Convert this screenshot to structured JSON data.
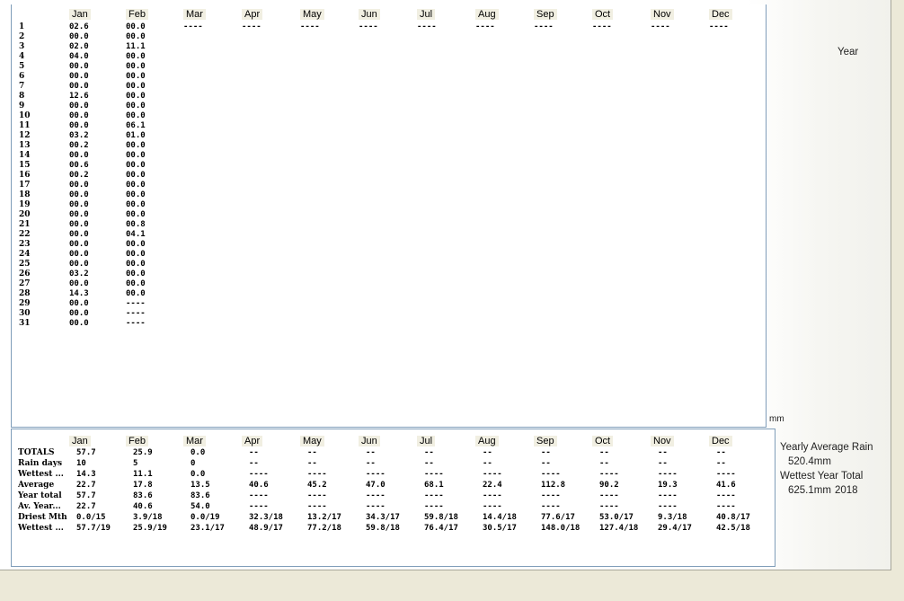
{
  "months": [
    "Jan",
    "Feb",
    "Mar",
    "Apr",
    "May",
    "Jun",
    "Jul",
    "Aug",
    "Sep",
    "Oct",
    "Nov",
    "Dec"
  ],
  "daily": {
    "days": [
      "1",
      "2",
      "3",
      "4",
      "5",
      "6",
      "7",
      "8",
      "9",
      "10",
      "11",
      "12",
      "13",
      "14",
      "15",
      "16",
      "17",
      "18",
      "19",
      "20",
      "21",
      "22",
      "23",
      "24",
      "25",
      "26",
      "27",
      "28",
      "29",
      "30",
      "31"
    ],
    "jan": [
      "02.6",
      "00.0",
      "02.0",
      "04.0",
      "00.0",
      "00.0",
      "00.0",
      "12.6",
      "00.0",
      "00.0",
      "00.0",
      "03.2",
      "00.2",
      "00.0",
      "00.6",
      "00.2",
      "00.0",
      "00.0",
      "00.0",
      "00.0",
      "00.0",
      "00.0",
      "00.0",
      "00.0",
      "00.0",
      "03.2",
      "00.0",
      "14.3",
      "00.0",
      "00.0",
      "00.0"
    ],
    "feb": [
      "00.0",
      "00.0",
      "11.1",
      "00.0",
      "00.0",
      "00.0",
      "00.0",
      "00.0",
      "00.0",
      "00.0",
      "06.1",
      "01.0",
      "00.0",
      "00.0",
      "00.0",
      "00.0",
      "00.0",
      "00.0",
      "00.0",
      "00.0",
      "00.8",
      "04.1",
      "00.0",
      "00.0",
      "00.0",
      "00.0",
      "00.0",
      "00.0",
      "----",
      "----",
      "----"
    ],
    "placeholder": "----"
  },
  "summary": {
    "rows": [
      {
        "label": "TOTALS",
        "values": [
          "57.7",
          "25.9",
          "0.0",
          "--",
          "--",
          "--",
          "--",
          "--",
          "--",
          "--",
          "--",
          "--"
        ]
      },
      {
        "label": "Rain days",
        "values": [
          "10",
          "5",
          "0",
          "--",
          "--",
          "--",
          "--",
          "--",
          "--",
          "--",
          "--",
          "--"
        ]
      },
      {
        "label": "Wettest ...",
        "values": [
          "14.3",
          "11.1",
          "0.0",
          "----",
          "----",
          "----",
          "----",
          "----",
          "----",
          "----",
          "----",
          "----"
        ]
      },
      {
        "label": "Average",
        "values": [
          "22.7",
          "17.8",
          "13.5",
          "40.6",
          "45.2",
          "47.0",
          "68.1",
          "22.4",
          "112.8",
          "90.2",
          "19.3",
          "41.6"
        ]
      },
      {
        "label": "Year total",
        "values": [
          "57.7",
          "83.6",
          "83.6",
          "----",
          "----",
          "----",
          "----",
          "----",
          "----",
          "----",
          "----",
          "----"
        ]
      },
      {
        "label": "Av. Year...",
        "values": [
          "22.7",
          "40.6",
          "54.0",
          "----",
          "----",
          "----",
          "----",
          "----",
          "----",
          "----",
          "----",
          "----"
        ]
      },
      {
        "label": "Driest Mth",
        "values": [
          "0.0/15",
          "3.9/18",
          "0.0/19",
          "32.3/18",
          "13.2/17",
          "34.3/17",
          "59.8/18",
          "14.4/18",
          "77.6/17",
          "53.0/17",
          "9.3/18",
          "40.8/17"
        ]
      },
      {
        "label": "Wettest ...",
        "values": [
          "57.7/19",
          "25.9/19",
          "23.1/17",
          "48.9/17",
          "77.2/18",
          "59.8/18",
          "76.4/17",
          "30.5/17",
          "148.0/18",
          "127.4/18",
          "29.4/17",
          "42.5/18"
        ]
      }
    ]
  },
  "side": {
    "year_label": "Year",
    "unit": "mm",
    "yearly_avg_label": "Yearly Average Rain",
    "yearly_avg_value": "520.4mm",
    "wettest_label": "Wettest Year Total",
    "wettest_value": "625.1mm",
    "wettest_year": "2018"
  }
}
